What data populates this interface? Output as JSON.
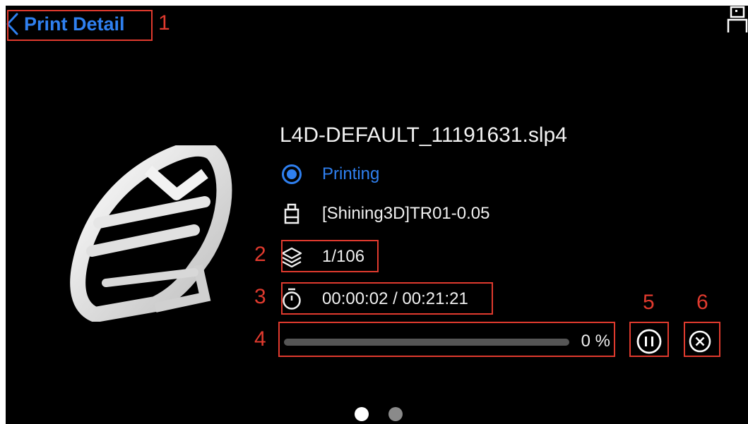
{
  "header": {
    "back_label": "Print Detail",
    "icons": {
      "back": "chevron-left-icon",
      "printer": "printer-icon"
    }
  },
  "job": {
    "filename": "L4D-DEFAULT_11191631.slp4",
    "status": "Printing",
    "resin": "[Shining3D]TR01-0.05",
    "layers": "1/106",
    "time": "00:00:02 / 00:21:21",
    "progress_percent": 0,
    "progress_label": "0 %"
  },
  "icons": {
    "status": "radio-status-icon",
    "resin": "resin-bottle-icon",
    "layers": "layers-icon",
    "time": "timer-icon",
    "pause": "pause-icon",
    "stop": "stop-icon"
  },
  "pager": {
    "pages": 2,
    "active": 1
  },
  "annotations": [
    "1",
    "2",
    "3",
    "4",
    "5",
    "6"
  ],
  "colors": {
    "accent": "#2f80f0",
    "background": "#000000",
    "annotation": "#e03a2e",
    "text": "#f0f0f0"
  }
}
